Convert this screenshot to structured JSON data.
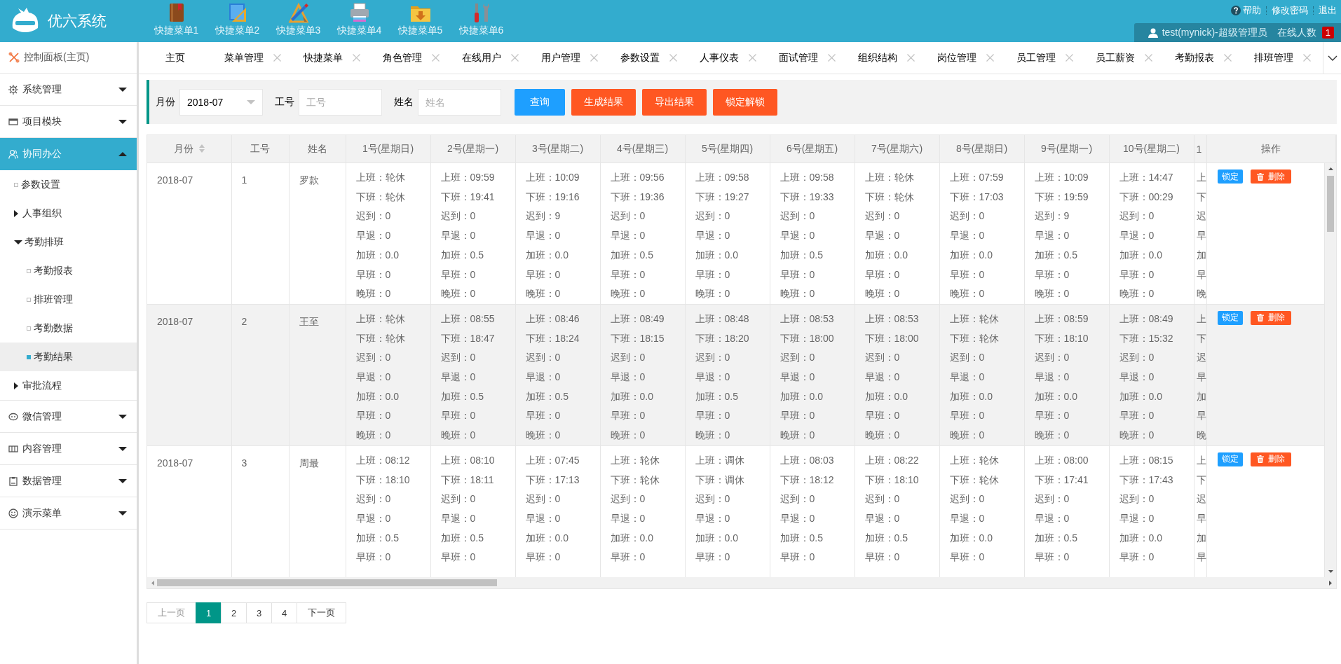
{
  "header": {
    "title": "优六系统",
    "quick_menu": [
      {
        "label": "快捷菜单1"
      },
      {
        "label": "快捷菜单2"
      },
      {
        "label": "快捷菜单3"
      },
      {
        "label": "快捷菜单4"
      },
      {
        "label": "快捷菜单5"
      },
      {
        "label": "快捷菜单6"
      }
    ],
    "links": [
      "帮助",
      "修改密码",
      "退出"
    ],
    "user": "test(mynick)-超级管理员",
    "online_label": "在线人数",
    "online_count": "1"
  },
  "sidebar": {
    "home": "控制面板(主页)",
    "groups": [
      {
        "label": "系统管理",
        "expanded": false
      },
      {
        "label": "项目模块",
        "expanded": false
      },
      {
        "label": "协同办公",
        "expanded": true,
        "children": [
          {
            "label": "参数设置",
            "kind": "leaf",
            "selected": false
          },
          {
            "label": "人事组织",
            "kind": "folder",
            "expanded": false,
            "selected": false
          },
          {
            "label": "考勤排班",
            "kind": "folder",
            "expanded": true,
            "selected": false,
            "children": [
              {
                "label": "考勤报表",
                "selected": false
              },
              {
                "label": "排班管理",
                "selected": false
              },
              {
                "label": "考勤数据",
                "selected": false
              },
              {
                "label": "考勤结果",
                "selected": true
              }
            ]
          },
          {
            "label": "审批流程",
            "kind": "folder",
            "expanded": false,
            "selected": false
          }
        ]
      },
      {
        "label": "微信管理",
        "expanded": false
      },
      {
        "label": "内容管理",
        "expanded": false
      },
      {
        "label": "数据管理",
        "expanded": false
      },
      {
        "label": "演示菜单",
        "expanded": false
      }
    ]
  },
  "tabs": [
    {
      "label": "主页",
      "closable": false
    },
    {
      "label": "菜单管理",
      "closable": true
    },
    {
      "label": "快捷菜单",
      "closable": true
    },
    {
      "label": "角色管理",
      "closable": true
    },
    {
      "label": "在线用户",
      "closable": true
    },
    {
      "label": "用户管理",
      "closable": true
    },
    {
      "label": "参数设置",
      "closable": true
    },
    {
      "label": "人事仪表",
      "closable": true
    },
    {
      "label": "面试管理",
      "closable": true
    },
    {
      "label": "组织结构",
      "closable": true
    },
    {
      "label": "岗位管理",
      "closable": true
    },
    {
      "label": "员工管理",
      "closable": true
    },
    {
      "label": "员工薪资",
      "closable": true
    },
    {
      "label": "考勤报表",
      "closable": true
    },
    {
      "label": "排班管理",
      "closable": true
    }
  ],
  "filter": {
    "fields": [
      {
        "label": "月份",
        "kind": "select",
        "value": "2018-07"
      },
      {
        "label": "工号",
        "kind": "input",
        "placeholder": "工号"
      },
      {
        "label": "姓名",
        "kind": "input",
        "placeholder": "姓名"
      }
    ],
    "buttons": [
      {
        "label": "查询",
        "kind": "normal"
      },
      {
        "label": "生成结果",
        "kind": "warm"
      },
      {
        "label": "导出结果",
        "kind": "warm"
      },
      {
        "label": "锁定解锁",
        "kind": "warm"
      }
    ]
  },
  "table": {
    "columns": [
      {
        "label": "月份",
        "kind": "text",
        "sortable": true
      },
      {
        "label": "工号",
        "kind": "text",
        "sortable": false
      },
      {
        "label": "姓名",
        "kind": "text",
        "sortable": false
      },
      {
        "label": "1号(星期日)",
        "kind": "day",
        "sortable": false
      },
      {
        "label": "2号(星期一)",
        "kind": "day",
        "sortable": false
      },
      {
        "label": "3号(星期二)",
        "kind": "day",
        "sortable": false
      },
      {
        "label": "4号(星期三)",
        "kind": "day",
        "sortable": false
      },
      {
        "label": "5号(星期四)",
        "kind": "day",
        "sortable": false
      },
      {
        "label": "6号(星期五)",
        "kind": "day",
        "sortable": false
      },
      {
        "label": "7号(星期六)",
        "kind": "day",
        "sortable": false
      },
      {
        "label": "8号(星期日)",
        "kind": "day",
        "sortable": false
      },
      {
        "label": "9号(星期一)",
        "kind": "day",
        "sortable": false
      },
      {
        "label": "10号(星期二)",
        "kind": "day",
        "sortable": false
      },
      {
        "label": "1",
        "kind": "cut"
      },
      {
        "label": "操作",
        "kind": "actions",
        "sortable": false
      }
    ],
    "rows": [
      {
        "month": "2018-07",
        "id": "1",
        "name": "罗款",
        "days": [
          [
            "上班：轮休",
            "下班：轮休",
            "迟到：0",
            "早退：0",
            "加班：0.0",
            "早班：0",
            "晚班：0"
          ],
          [
            "上班：09:59",
            "下班：19:41",
            "迟到：0",
            "早退：0",
            "加班：0.5",
            "早班：0",
            "晚班：0"
          ],
          [
            "上班：10:09",
            "下班：19:16",
            "迟到：9",
            "早退：0",
            "加班：0.0",
            "早班：0",
            "晚班：0"
          ],
          [
            "上班：09:56",
            "下班：19:36",
            "迟到：0",
            "早退：0",
            "加班：0.5",
            "早班：0",
            "晚班：0"
          ],
          [
            "上班：09:58",
            "下班：19:27",
            "迟到：0",
            "早退：0",
            "加班：0.0",
            "早班：0",
            "晚班：0"
          ],
          [
            "上班：09:58",
            "下班：19:33",
            "迟到：0",
            "早退：0",
            "加班：0.5",
            "早班：0",
            "晚班：0"
          ],
          [
            "上班：轮休",
            "下班：轮休",
            "迟到：0",
            "早退：0",
            "加班：0.0",
            "早班：0",
            "晚班：0"
          ],
          [
            "上班：07:59",
            "下班：17:03",
            "迟到：0",
            "早退：0",
            "加班：0.0",
            "早班：0",
            "晚班：0"
          ],
          [
            "上班：10:09",
            "下班：19:59",
            "迟到：9",
            "早退：0",
            "加班：0.5",
            "早班：0",
            "晚班：0"
          ],
          [
            "上班：14:47",
            "下班：00:29",
            "迟到：0",
            "早退：0",
            "加班：0.0",
            "早班：0",
            "晚班：0"
          ],
          [
            "上",
            "下",
            "迟",
            "早",
            "加",
            "早",
            "晚"
          ]
        ],
        "actions": [
          {
            "label": "锁定",
            "kind": "lock"
          },
          {
            "label": "删除",
            "kind": "delete"
          }
        ]
      },
      {
        "month": "2018-07",
        "id": "2",
        "name": "王至",
        "days": [
          [
            "上班：轮休",
            "下班：轮休",
            "迟到：0",
            "早退：0",
            "加班：0.0",
            "早班：0",
            "晚班：0"
          ],
          [
            "上班：08:55",
            "下班：18:47",
            "迟到：0",
            "早退：0",
            "加班：0.5",
            "早班：0",
            "晚班：0"
          ],
          [
            "上班：08:46",
            "下班：18:24",
            "迟到：0",
            "早退：0",
            "加班：0.5",
            "早班：0",
            "晚班：0"
          ],
          [
            "上班：08:49",
            "下班：18:15",
            "迟到：0",
            "早退：0",
            "加班：0.0",
            "早班：0",
            "晚班：0"
          ],
          [
            "上班：08:48",
            "下班：18:20",
            "迟到：0",
            "早退：0",
            "加班：0.5",
            "早班：0",
            "晚班：0"
          ],
          [
            "上班：08:53",
            "下班：18:00",
            "迟到：0",
            "早退：0",
            "加班：0.0",
            "早班：0",
            "晚班：0"
          ],
          [
            "上班：08:53",
            "下班：18:00",
            "迟到：0",
            "早退：0",
            "加班：0.0",
            "早班：0",
            "晚班：0"
          ],
          [
            "上班：轮休",
            "下班：轮休",
            "迟到：0",
            "早退：0",
            "加班：0.0",
            "早班：0",
            "晚班：0"
          ],
          [
            "上班：08:59",
            "下班：18:10",
            "迟到：0",
            "早退：0",
            "加班：0.0",
            "早班：0",
            "晚班：0"
          ],
          [
            "上班：08:49",
            "下班：15:32",
            "迟到：0",
            "早退：0",
            "加班：0.0",
            "早班：0",
            "晚班：0"
          ],
          [
            "上",
            "下",
            "迟",
            "早",
            "加",
            "早",
            "晚"
          ]
        ],
        "actions": [
          {
            "label": "锁定",
            "kind": "lock"
          },
          {
            "label": "删除",
            "kind": "delete"
          }
        ]
      },
      {
        "month": "2018-07",
        "id": "3",
        "name": "周最",
        "days": [
          [
            "上班：08:12",
            "下班：18:10",
            "迟到：0",
            "早退：0",
            "加班：0.5",
            "早班：0"
          ],
          [
            "上班：08:10",
            "下班：18:11",
            "迟到：0",
            "早退：0",
            "加班：0.5",
            "早班：0"
          ],
          [
            "上班：07:45",
            "下班：17:13",
            "迟到：0",
            "早退：0",
            "加班：0.0",
            "早班：0"
          ],
          [
            "上班：轮休",
            "下班：轮休",
            "迟到：0",
            "早退：0",
            "加班：0.0",
            "早班：0"
          ],
          [
            "上班：调休",
            "下班：调休",
            "迟到：0",
            "早退：0",
            "加班：0.0",
            "早班：0"
          ],
          [
            "上班：08:03",
            "下班：18:12",
            "迟到：0",
            "早退：0",
            "加班：0.5",
            "早班：0"
          ],
          [
            "上班：08:22",
            "下班：18:10",
            "迟到：0",
            "早退：0",
            "加班：0.5",
            "早班：0"
          ],
          [
            "上班：轮休",
            "下班：轮休",
            "迟到：0",
            "早退：0",
            "加班：0.0",
            "早班：0"
          ],
          [
            "上班：08:00",
            "下班：17:41",
            "迟到：0",
            "早退：0",
            "加班：0.5",
            "早班：0"
          ],
          [
            "上班：08:15",
            "下班：17:43",
            "迟到：0",
            "早退：0",
            "加班：0.0",
            "早班：0"
          ],
          [
            "上",
            "下",
            "迟",
            "早",
            "加",
            "早"
          ]
        ],
        "actions": [
          {
            "label": "锁定",
            "kind": "lock"
          },
          {
            "label": "删除",
            "kind": "delete"
          }
        ]
      }
    ]
  },
  "pagination": {
    "prev": {
      "label": "上一页",
      "disabled": true
    },
    "pages": [
      {
        "label": "1",
        "selected": true
      },
      {
        "label": "2",
        "selected": false
      },
      {
        "label": "3",
        "selected": false
      },
      {
        "label": "4",
        "selected": false
      }
    ],
    "next": {
      "label": "下一页",
      "disabled": false
    }
  }
}
